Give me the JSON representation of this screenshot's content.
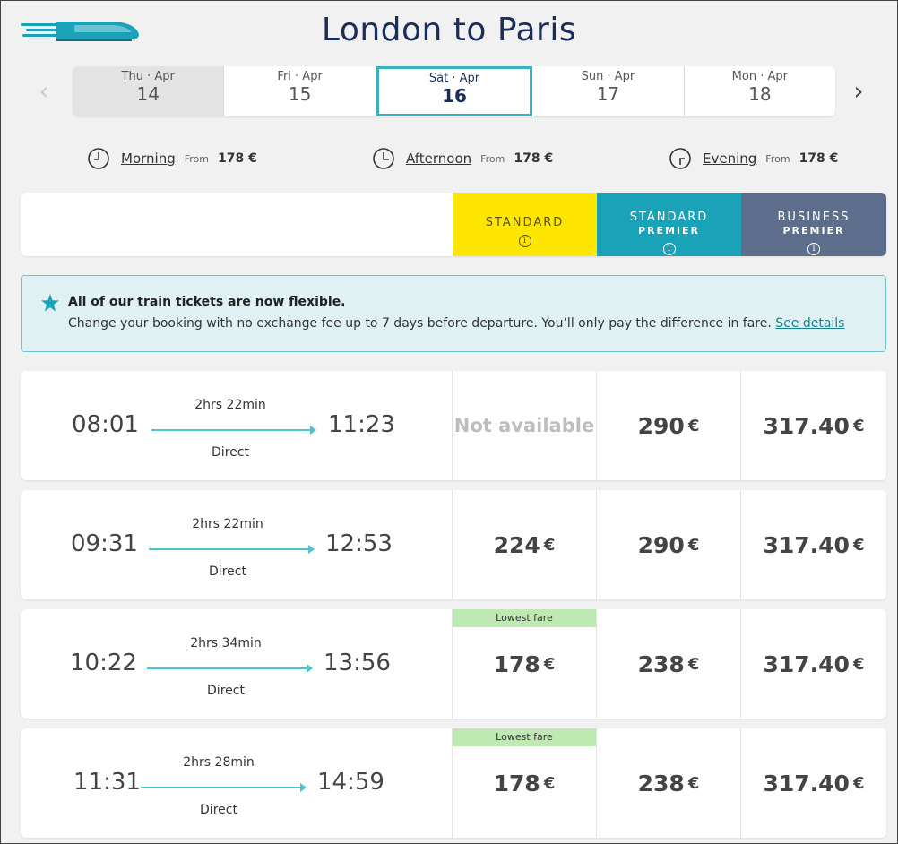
{
  "header": {
    "title": "London to Paris"
  },
  "dates": [
    {
      "dow": "Thu · Apr",
      "day": "14"
    },
    {
      "dow": "Fri · Apr",
      "day": "15"
    },
    {
      "dow": "Sat · Apr",
      "day": "16"
    },
    {
      "dow": "Sun · Apr",
      "day": "17"
    },
    {
      "dow": "Mon · Apr",
      "day": "18"
    }
  ],
  "nav": {
    "prev_icon": "chevron-left-icon",
    "next_icon": "chevron-right-icon"
  },
  "time_filters": [
    {
      "label": "Morning",
      "from": "From",
      "price": "178 €"
    },
    {
      "label": "Afternoon",
      "from": "From",
      "price": "178 €"
    },
    {
      "label": "Evening",
      "from": "From",
      "price": "178 €"
    }
  ],
  "classes": [
    {
      "name": "STANDARD",
      "sub": "",
      "color": "#ffe600"
    },
    {
      "name": "STANDARD",
      "sub": "PREMIER",
      "color": "#1aa3b8"
    },
    {
      "name": "BUSINESS",
      "sub": "PREMIER",
      "color": "#5d6d8c"
    }
  ],
  "banner": {
    "title": "All of our train tickets are now flexible.",
    "text": "Change your booking with no exchange fee up to 7 days before departure. You’ll only pay the difference in fare. ",
    "link": "See details"
  },
  "journeys": [
    {
      "depart": "08:01",
      "arrive": "11:23",
      "duration": "2hrs 22min",
      "type": "Direct",
      "fares": [
        {
          "price": "Not available",
          "currency": "",
          "badge": ""
        },
        {
          "price": "290",
          "currency": "€",
          "badge": ""
        },
        {
          "price": "317.40",
          "currency": "€",
          "badge": ""
        }
      ]
    },
    {
      "depart": "09:31",
      "arrive": "12:53",
      "duration": "2hrs 22min",
      "type": "Direct",
      "fares": [
        {
          "price": "224",
          "currency": "€",
          "badge": ""
        },
        {
          "price": "290",
          "currency": "€",
          "badge": ""
        },
        {
          "price": "317.40",
          "currency": "€",
          "badge": ""
        }
      ]
    },
    {
      "depart": "10:22",
      "arrive": "13:56",
      "duration": "2hrs 34min",
      "type": "Direct",
      "fares": [
        {
          "price": "178",
          "currency": "€",
          "badge": "Lowest fare"
        },
        {
          "price": "238",
          "currency": "€",
          "badge": ""
        },
        {
          "price": "317.40",
          "currency": "€",
          "badge": ""
        }
      ]
    },
    {
      "depart": "11:31",
      "arrive": "14:59",
      "duration": "2hrs 28min",
      "type": "Direct",
      "fares": [
        {
          "price": "178",
          "currency": "€",
          "badge": "Lowest fare"
        },
        {
          "price": "238",
          "currency": "€",
          "badge": ""
        },
        {
          "price": "317.40",
          "currency": "€",
          "badge": ""
        }
      ]
    }
  ]
}
